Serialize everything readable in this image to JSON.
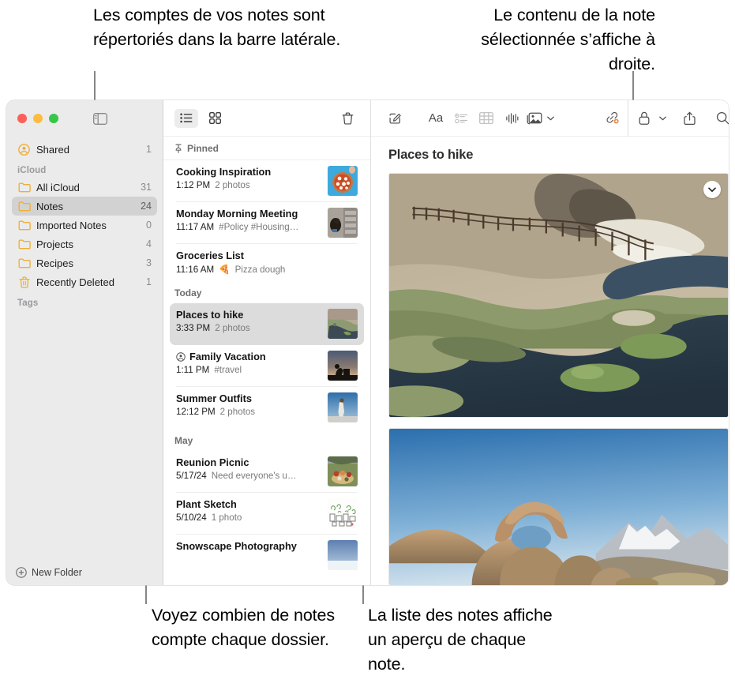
{
  "callouts": {
    "top_left": "Les comptes de vos notes sont répertoriés dans la barre latérale.",
    "top_right": "Le contenu de la note sélectionnée s’affiche à droite.",
    "bottom_left": "Voyez combien de notes compte chaque dossier.",
    "bottom_right": "La liste des notes affiche un aperçu de chaque note."
  },
  "sidebar": {
    "toggle_icon": "sidebar-toggle-icon",
    "shared": {
      "label": "Shared",
      "count": "1",
      "icon": "shared-person-icon"
    },
    "section_icloud": "iCloud",
    "section_tags": "Tags",
    "items": [
      {
        "label": "All iCloud",
        "count": "31",
        "icon": "folder-icon",
        "selected": false
      },
      {
        "label": "Notes",
        "count": "24",
        "icon": "folder-icon",
        "selected": true
      },
      {
        "label": "Imported Notes",
        "count": "0",
        "icon": "folder-icon",
        "selected": false
      },
      {
        "label": "Projects",
        "count": "4",
        "icon": "folder-icon",
        "selected": false
      },
      {
        "label": "Recipes",
        "count": "3",
        "icon": "folder-icon",
        "selected": false
      },
      {
        "label": "Recently Deleted",
        "count": "1",
        "icon": "trash-icon",
        "selected": false
      }
    ],
    "new_folder": {
      "label": "New Folder",
      "icon": "plus-circle-icon"
    }
  },
  "notelist": {
    "toolbar": {
      "list_view": "list-view-icon",
      "gallery_view": "gallery-view-icon",
      "delete": "trash-icon"
    },
    "groups": [
      {
        "label": "Pinned",
        "icon": "pin-icon",
        "notes": [
          {
            "title": "Cooking Inspiration",
            "time": "1:12 PM",
            "preview": "2 photos",
            "thumb": "pizza",
            "shared": false
          },
          {
            "title": "Monday Morning Meeting",
            "time": "11:17 AM",
            "preview": "#Policy #Housing…",
            "thumb": "street",
            "shared": false
          },
          {
            "title": "Groceries List",
            "time": "11:16 AM",
            "preview": "Pizza dough",
            "preview_emoji": "🍕",
            "thumb": "",
            "shared": false
          }
        ]
      },
      {
        "label": "Today",
        "icon": "",
        "notes": [
          {
            "title": "Places to hike",
            "time": "3:33 PM",
            "preview": "2 photos",
            "thumb": "river",
            "shared": false,
            "selected": true
          },
          {
            "title": "Family Vacation",
            "time": "1:11 PM",
            "preview": "#travel",
            "thumb": "sunset",
            "shared": true
          },
          {
            "title": "Summer Outfits",
            "time": "12:12 PM",
            "preview": "2 photos",
            "thumb": "outfit",
            "shared": false
          }
        ]
      },
      {
        "label": "May",
        "icon": "",
        "notes": [
          {
            "title": "Reunion Picnic",
            "time": "5/17/24",
            "preview": "Need everyone's u…",
            "thumb": "picnic",
            "shared": false
          },
          {
            "title": "Plant Sketch",
            "time": "5/10/24",
            "preview": "1 photo",
            "thumb": "plants",
            "shared": false
          },
          {
            "title": "Snowscape Photography",
            "time": "",
            "preview": "",
            "thumb": "snow",
            "shared": false
          }
        ]
      }
    ]
  },
  "detail": {
    "toolbar": [
      {
        "name": "compose-icon",
        "label": "Compose"
      },
      {
        "name": "format-aa-icon",
        "label": "Aa"
      },
      {
        "name": "checklist-icon",
        "label": "Checklist"
      },
      {
        "name": "table-icon",
        "label": "Table"
      },
      {
        "name": "audio-waveform-icon",
        "label": "Audio"
      },
      {
        "name": "media-icon",
        "label": "Media"
      },
      {
        "name": "link-icon",
        "label": "Link"
      },
      {
        "name": "lock-icon",
        "label": "Lock"
      },
      {
        "name": "share-icon",
        "label": "Share"
      },
      {
        "name": "search-icon",
        "label": "Search"
      }
    ],
    "note_title": "Places to hike",
    "photo_chevron_icon": "chevron-down-icon"
  },
  "colors": {
    "folder_yellow": "#f0ae38",
    "accent_selected": "#d2d2d2",
    "sidebar_bg": "#ebebeb",
    "traffic_red": "#fc6058",
    "traffic_yellow": "#fdbc40",
    "traffic_green": "#34c749"
  }
}
